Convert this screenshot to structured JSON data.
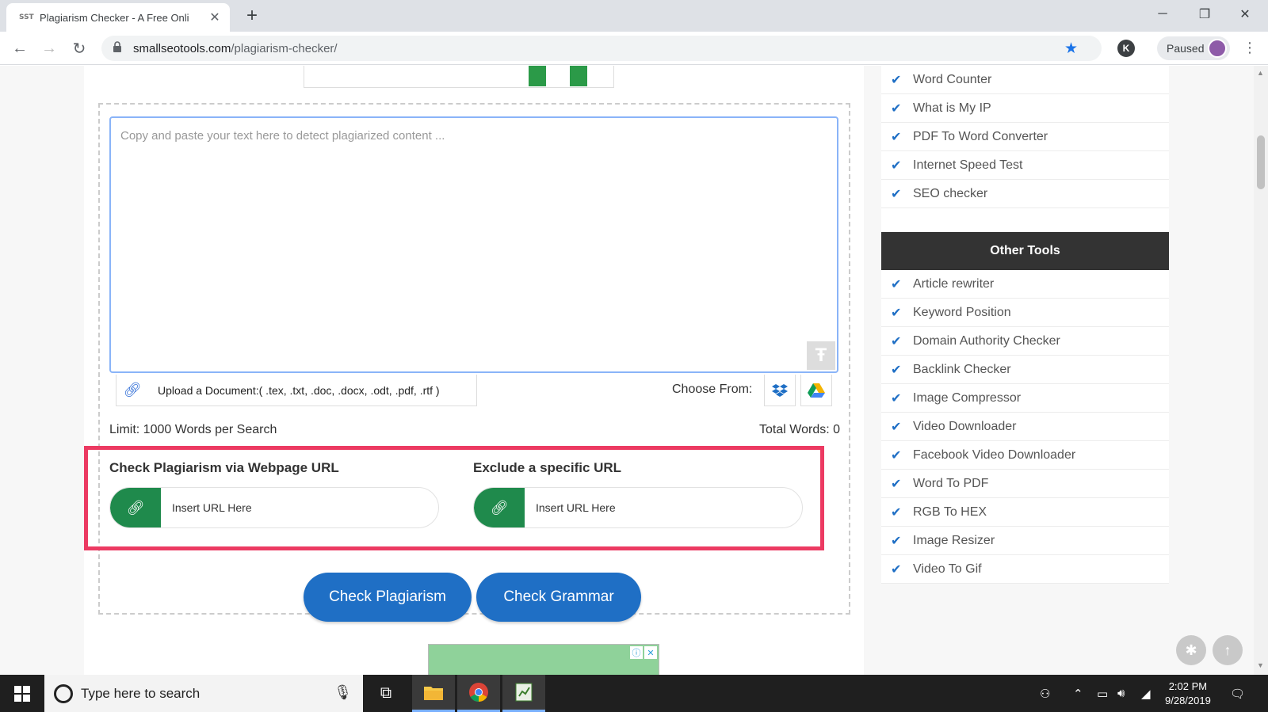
{
  "browser": {
    "tab_title": "Plagiarism Checker - A Free Onli",
    "favicon_text": "SST",
    "url_host": "smallseotools.com",
    "url_path": "/plagiarism-checker/",
    "profile_initial": "K",
    "paused_label": "Paused",
    "window_controls": [
      "minimize",
      "restore",
      "close"
    ]
  },
  "editor": {
    "placeholder": "Copy and paste your text here to detect plagiarized content ...",
    "upload_label": "Upload a Document:( .tex, .txt, .doc, .docx, .odt, .pdf, .rtf )",
    "choose_from_label": "Choose From:",
    "sources": [
      "dropbox-icon",
      "google-drive-icon"
    ],
    "limit_text": "Limit: 1000 Words per Search",
    "total_words_text": "Total Words: 0"
  },
  "url_checks": {
    "webpage": {
      "title": "Check Plagiarism via Webpage URL",
      "placeholder": "Insert URL Here"
    },
    "exclude": {
      "title": "Exclude a specific URL",
      "placeholder": "Insert URL Here"
    }
  },
  "actions": {
    "check_plagiarism": "Check Plagiarism",
    "check_grammar": "Check Grammar"
  },
  "sidebar": {
    "top_items": [
      "Word Counter",
      "What is My IP",
      "PDF To Word Converter",
      "Internet Speed Test",
      "SEO checker"
    ],
    "other_tools_title": "Other Tools",
    "other_items": [
      "Article rewriter",
      "Keyword Position",
      "Domain Authority Checker",
      "Backlink Checker",
      "Image Compressor",
      "Video Downloader",
      "Facebook Video Downloader",
      "Word To PDF",
      "RGB To HEX",
      "Image Resizer",
      "Video To Gif"
    ]
  },
  "taskbar": {
    "search_placeholder": "Type here to search",
    "time": "2:02 PM",
    "date": "9/28/2019"
  },
  "colors": {
    "accent_blue": "#1f6fc5",
    "green": "#1f8a4c",
    "highlight": "#ec3a62",
    "dark_header": "#333333"
  }
}
